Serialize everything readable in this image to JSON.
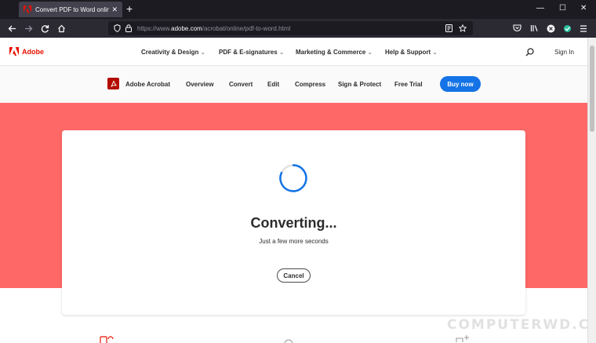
{
  "browser": {
    "tab_title": "Convert PDF to Word online for",
    "tab_close": "✕",
    "new_tab": "+",
    "window_controls": {
      "minimize": "—",
      "maximize": "☐",
      "close": "✕"
    },
    "url_prefix": "https://www.",
    "url_host": "adobe.com",
    "url_path": "/acrobat/online/pdf-to-word.html"
  },
  "gnav": {
    "brand": "Adobe",
    "items": [
      {
        "label": "Creativity & Design"
      },
      {
        "label": "PDF & E-signatures"
      },
      {
        "label": "Marketing & Commerce"
      },
      {
        "label": "Help & Support"
      }
    ],
    "caret": "⌄",
    "signin": "Sign In"
  },
  "lnav": {
    "product": "Adobe Acrobat",
    "items": [
      "Overview",
      "Convert",
      "Edit",
      "Compress",
      "Sign & Protect",
      "Free Trial"
    ],
    "cta": "Buy now"
  },
  "card": {
    "title": "Converting...",
    "subtitle": "Just a few more seconds",
    "cancel": "Cancel"
  },
  "watermark": "COMPUTERWD.COM",
  "colors": {
    "adobe_red": "#eb1000",
    "hero": "#fe6867",
    "cta_blue": "#1473e6",
    "spinner": "#1473e6"
  }
}
